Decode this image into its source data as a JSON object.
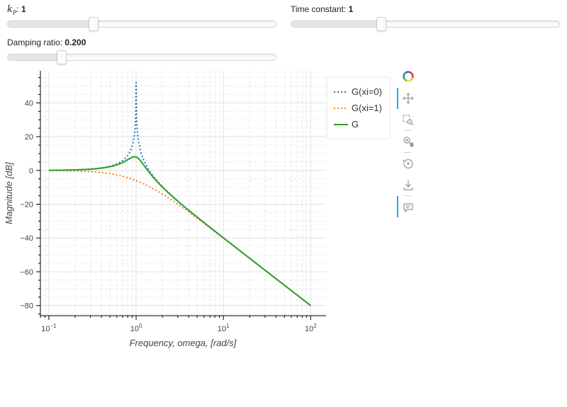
{
  "sliders": {
    "kp": {
      "label_prefix": "k",
      "label_sub": "P",
      "label_suffix": ": ",
      "value": "1",
      "fraction": 0.32
    },
    "time_constant": {
      "label": "Time constant: ",
      "value": "1",
      "fraction": 0.335
    },
    "damping_ratio": {
      "label": "Damping ratio: ",
      "value": "0.200",
      "fraction": 0.2
    }
  },
  "chart_data": {
    "type": "line",
    "xlabel": "Frequency, omega, [rad/s]",
    "ylabel": "Magnitude [dB]",
    "x_scale": "log",
    "xlim": [
      0.08,
      150
    ],
    "ylim": [
      -86,
      59
    ],
    "x_ticks": [
      {
        "base": "10",
        "exp": "−1",
        "value": 0.1
      },
      {
        "base": "10",
        "exp": "0",
        "value": 1
      },
      {
        "base": "10",
        "exp": "1",
        "value": 10
      },
      {
        "base": "10",
        "exp": "2",
        "value": 100
      }
    ],
    "y_ticks": [
      {
        "label": "40",
        "value": 40
      },
      {
        "label": "20",
        "value": 20
      },
      {
        "label": "0",
        "value": 0
      },
      {
        "label": "−20",
        "value": -20
      },
      {
        "label": "−40",
        "value": -40
      },
      {
        "label": "−60",
        "value": -60
      },
      {
        "label": "−80",
        "value": -80
      }
    ],
    "grid": true,
    "legend_position": "top-right-outside",
    "series": [
      {
        "name": "G(xi=0)",
        "xi": 0,
        "color": "#1f77b4",
        "dash": "dotted",
        "peak_db": 52
      },
      {
        "name": "G(xi=1)",
        "xi": 1,
        "color": "#ff7f0e",
        "dash": "dotted"
      },
      {
        "name": "G",
        "xi": 0.2,
        "color": "#2ca02c",
        "dash": "solid"
      }
    ],
    "x_range": [
      0.1,
      100
    ],
    "transfer_function": "kp / ((tau*s)^2 + 2*xi*tau*s + 1)",
    "kp": 1,
    "tau": 1
  },
  "toolbar": {
    "tools": [
      {
        "name": "bokeh-logo-icon"
      },
      {
        "name": "pan-icon",
        "active": true
      },
      {
        "name": "box-zoom-icon"
      },
      {
        "name": "wheel-zoom-icon"
      },
      {
        "name": "reset-icon"
      },
      {
        "name": "save-icon"
      },
      {
        "name": "hover-icon",
        "active": true
      }
    ]
  }
}
